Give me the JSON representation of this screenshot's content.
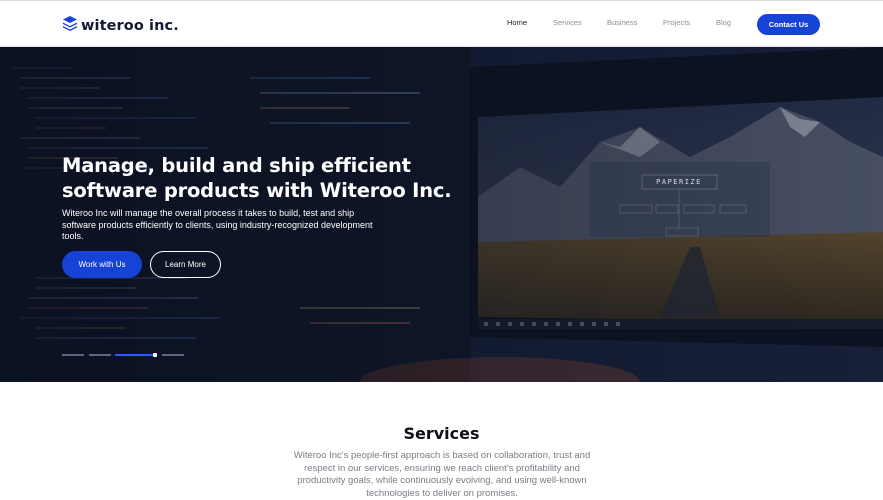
{
  "brand": {
    "name": "witeroo inc.",
    "logo_icon": "stacked-layers-icon",
    "accent": "#1742d6"
  },
  "nav": {
    "items": [
      {
        "label": "Home",
        "active": true
      },
      {
        "label": "Services",
        "active": false
      },
      {
        "label": "Business",
        "active": false
      },
      {
        "label": "Projects",
        "active": false
      },
      {
        "label": "Blog",
        "active": false
      }
    ],
    "cta_label": "Contact Us"
  },
  "hero": {
    "title": "Manage, build and ship efficient software products with Witeroo Inc.",
    "subtitle": "Witeroo Inc will manage the overall process it takes to build, test and ship software products efficiently to clients, using industry-recognized development tools.",
    "primary_button": "Work with Us",
    "secondary_button": "Learn More",
    "screen_caption": "PAPERIZE",
    "slider": {
      "count": 4,
      "active_index": 2
    }
  },
  "services": {
    "title": "Services",
    "description": "Witeroo Inc's people-first approach is based on collaboration, trust and respect in our services, ensuring we reach client's profitability and productivity goals, while continuously evolving, and using well-known technologies to deliver on promises."
  }
}
